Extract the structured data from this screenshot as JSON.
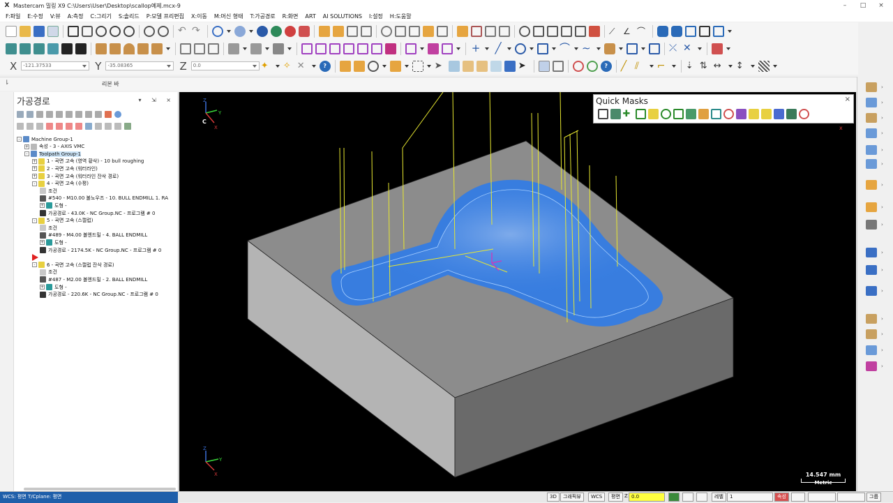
{
  "window": {
    "title": "Mastercam 밀링 X9  C:\\Users\\User\\Desktop\\scallop예제.mcx-9",
    "logo": "X",
    "controls": [
      "–",
      "□",
      "×"
    ]
  },
  "menu": [
    "F:파일",
    "E:수정",
    "V:뷰",
    "A:측정",
    "C:그리기",
    "S:솔리드",
    "P:모델 프리편집",
    "X:이동",
    "M:머신 형태",
    "T:가공경로",
    "R:화면",
    "ART",
    "AI SOLUTIONS",
    "I:설정",
    "H:도움말"
  ],
  "coords": {
    "x_label": "X",
    "x_value": "-121.37533",
    "y_label": "Y",
    "y_value": "-35.08365",
    "z_label": "Z",
    "z_value": "0.0"
  },
  "ribbon_bar": {
    "label": "리본 바",
    "pin": "⇂"
  },
  "panel": {
    "title": "가공경로",
    "controls": "▾ ⇲ ×",
    "tree": [
      {
        "label": "Machine Group-1",
        "level": 0,
        "expander": "-",
        "icon": "machine"
      },
      {
        "label": "속성 - 3 - AXIS VMC",
        "level": 1,
        "expander": "+",
        "icon": "props"
      },
      {
        "label": "Toolpath Group-1",
        "level": 1,
        "expander": "-",
        "icon": "group",
        "selected": true
      },
      {
        "label": "1 - 곡면 고속 (영역 황삭) - 10 bull roughing",
        "level": 2,
        "expander": "+",
        "icon": "op"
      },
      {
        "label": "2 - 곡면 고속 (워터라인)",
        "level": 2,
        "expander": "+",
        "icon": "op"
      },
      {
        "label": "3 - 곡면 고속 (워터라인 잔삭 경로)",
        "level": 2,
        "expander": "+",
        "icon": "op"
      },
      {
        "label": "4 - 곡면 고속 (수평)",
        "level": 2,
        "expander": "-",
        "icon": "op"
      },
      {
        "label": "조건",
        "level": 3,
        "expander": "",
        "icon": "folder"
      },
      {
        "label": "#540 - M10.00 불노우즈 - 10. BULL ENDMILL 1. RA",
        "level": 3,
        "expander": "",
        "icon": "tool"
      },
      {
        "label": "도형 -",
        "level": 3,
        "expander": "+",
        "icon": "geom"
      },
      {
        "label": "가공경로 - 43.0K - NC Group.NC - 프로그램 # 0",
        "level": 3,
        "expander": "",
        "icon": "path"
      },
      {
        "label": "5 - 곡면 고속 (스캘럽)",
        "level": 2,
        "expander": "-",
        "icon": "op"
      },
      {
        "label": "조건",
        "level": 3,
        "expander": "",
        "icon": "folder"
      },
      {
        "label": "#489 - M4.00 볼엔드밀 - 4. BALL ENDMILL",
        "level": 3,
        "expander": "",
        "icon": "tool"
      },
      {
        "label": "도형 -",
        "level": 3,
        "expander": "+",
        "icon": "geom"
      },
      {
        "label": "가공경로 - 2174.5K - NC Group.NC - 프로그램 # 0",
        "level": 3,
        "expander": "",
        "icon": "path"
      },
      {
        "label": "",
        "level": 2,
        "expander": "",
        "icon": "insert-arrow"
      },
      {
        "label": "6 - 곡면 고속 (스캘럽 잔삭 경로)",
        "level": 2,
        "expander": "-",
        "icon": "op"
      },
      {
        "label": "조건",
        "level": 3,
        "expander": "",
        "icon": "folder"
      },
      {
        "label": "#487 - M2.00 볼엔드밀 - 2. BALL ENDMILL",
        "level": 3,
        "expander": "",
        "icon": "tool"
      },
      {
        "label": "도형 -",
        "level": 3,
        "expander": "+",
        "icon": "geom"
      },
      {
        "label": "가공경로 - 220.6K - NC Group.NC - 프로그램 # 0",
        "level": 3,
        "expander": "",
        "icon": "path"
      }
    ]
  },
  "quick_masks": {
    "title": "Quick Masks",
    "close": "×"
  },
  "viewport": {
    "gnomon_top": {
      "z": "Z",
      "y": "Y",
      "x": "X",
      "c": "C"
    },
    "gnomon_bottom": {
      "z": "Z",
      "y": "Y",
      "x": "X"
    },
    "scale": {
      "value": "14.547 mm",
      "unit": "Metric"
    }
  },
  "status": {
    "wcs": "WCS: 평면  T/Cplane: 평면",
    "view_3d": "3D",
    "gview": "그래픽뷰",
    "wcs_btn": "WCS",
    "plane": "평면",
    "z_label": "Z",
    "z_value": "0.0",
    "level_label": "레벨",
    "level_value": "1",
    "attr": "속성",
    "group": "그룹"
  },
  "colors": {
    "accent_blue": "#1f5faa",
    "toolpath_blue": "#2f7be8",
    "toolpath_yellow": "#e8e830",
    "stock_gray": "#8a8a8a"
  }
}
